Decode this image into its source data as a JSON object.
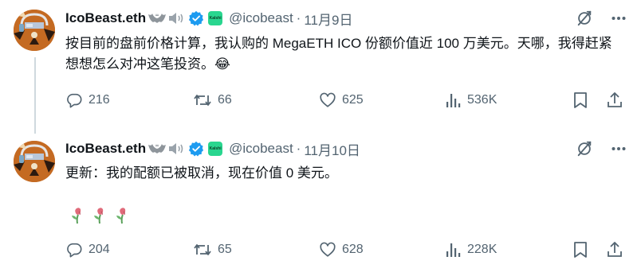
{
  "colors": {
    "text": "#0f1419",
    "secondary": "#536471",
    "verified": "#1d9bf0",
    "kalshi_badge": "#29d68f",
    "thread_line": "#cfd9de"
  },
  "tweets": [
    {
      "name": "IcoBeast.eth",
      "name_emoji": [
        "bat",
        "speaker"
      ],
      "handle": "@icobeast",
      "separator": "·",
      "date": "11月9日",
      "badge_text": "Kalshi",
      "text": "按目前的盘前价格计算，我认购的 MegaETH ICO 份额价值近 100 万美元。天哪，我得赶紧想想怎么对冲这笔投资。😂",
      "counts": {
        "replies": "216",
        "retweets": "66",
        "likes": "625",
        "views": "536K"
      }
    },
    {
      "name": "IcoBeast.eth",
      "name_emoji": [
        "bat",
        "speaker"
      ],
      "handle": "@icobeast",
      "separator": "·",
      "date": "11月10日",
      "badge_text": "Kalshi",
      "text": "更新：我的配额已被取消，现在价值 0 美元。",
      "roses": [
        "wilted-rose",
        "wilted-rose",
        "wilted-rose"
      ],
      "counts": {
        "replies": "204",
        "retweets": "65",
        "likes": "628",
        "views": "228K"
      }
    }
  ]
}
